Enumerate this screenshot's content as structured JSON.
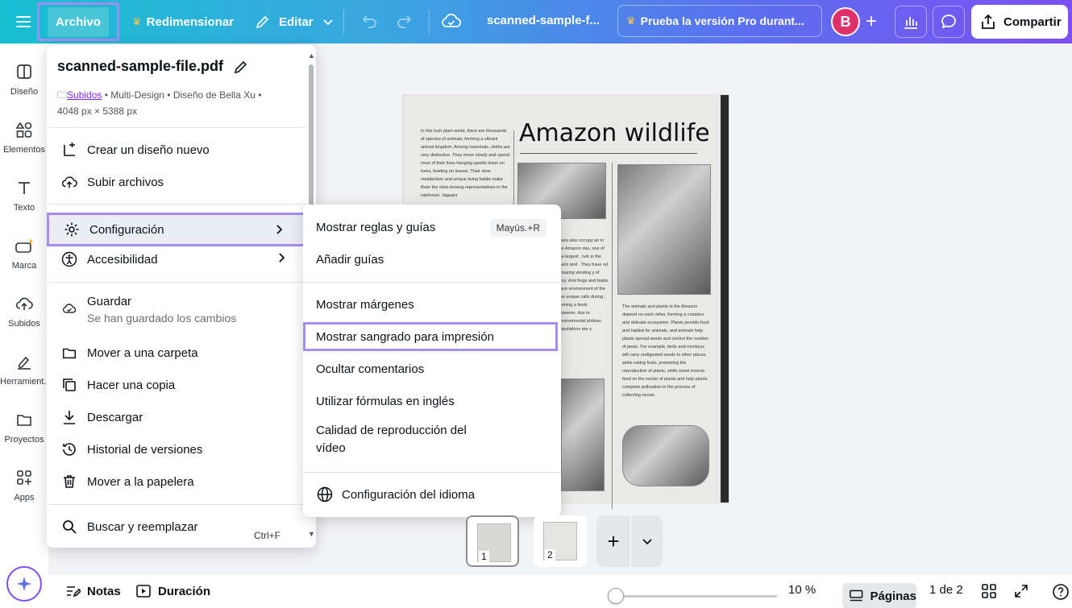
{
  "topbar": {
    "archivo": "Archivo",
    "resize": "Redimensionar",
    "edit": "Editar",
    "doc_name": "scanned-sample-f...",
    "pro_trial": "Prueba la versión Pro durant...",
    "avatar_initial": "B",
    "share": "Compartir"
  },
  "sidebar": {
    "items": [
      {
        "label": "Diseño"
      },
      {
        "label": "Elementos"
      },
      {
        "label": "Texto"
      },
      {
        "label": "Marca"
      },
      {
        "label": "Subidos"
      },
      {
        "label": "Herramient..."
      },
      {
        "label": "Proyectos"
      },
      {
        "label": "Apps"
      }
    ]
  },
  "file_menu": {
    "file_name": "scanned-sample-file.pdf",
    "meta_link": "Subidos",
    "meta_rest": " • Multi-Design • Diseño de Bella Xu •",
    "meta_size": "4048 px × 5388 px",
    "items": {
      "new_design": "Crear un diseño nuevo",
      "upload": "Subir archivos",
      "settings": "Configuración",
      "accessibility": "Accesibilidad",
      "save": "Guardar",
      "save_status": "Se han guardado los cambios",
      "move_folder": "Mover a una carpeta",
      "copy": "Hacer una copia",
      "download": "Descargar",
      "history": "Historial de versiones",
      "trash": "Mover a la papelera",
      "find_replace": "Buscar y reemplazar",
      "find_shortcut": "Ctrl+F"
    }
  },
  "settings_menu": {
    "rulers": "Mostrar reglas y guías",
    "rulers_shortcut": "Mayús.+R",
    "add_guides": "Añadir guías",
    "margins": "Mostrar márgenes",
    "bleed": "Mostrar sangrado para impresión",
    "hide_comments": "Ocultar comentarios",
    "english_formulas": "Utilizar fórmulas en inglés",
    "video_quality_1": "Calidad de reproducción del",
    "video_quality_2": "vídeo",
    "language": "Configuración del idioma"
  },
  "document": {
    "title": "Amazon wildlife",
    "col1": "In this lush plant world, there are thousands of species of animals, forming a vibrant animal kingdom. Among mammals, sloths are very distinctive. They move slowly and spend most of their lives hanging upside down on trees, feeding on leaves. Their slow metabolism and unique living habits make them the slow-moving representatives in the rainforest. Jaguars",
    "col2": "bians also occupy an in the Amazon das, one of the largest , lurk in the rivers and . They have nd amazing winding y of prey. And frogs and toads have environment of the ake unique calls during , forming a lively . However, due to environmental phibian populations are s.",
    "col3": "The animals and plants in the Amazon depend on each other, forming a complex and delicate ecosystem. Plants provide food and habitat for animals, and animals help plants spread seeds and control the number of pests. For example, birds and monkeys will carry undigested seeds to other places while eating fruits, promoting the reproduction of plants, while some insects feed on the nectar of plants and help plants complete pollination in the process of collecting nectar."
  },
  "pages": {
    "thumb1": "1",
    "thumb2": "2"
  },
  "bottombar": {
    "notes": "Notas",
    "duration": "Duración",
    "zoom": "10 %",
    "zoom_fraction": 0.0,
    "pages": "Páginas",
    "page_count": "1 de 2"
  }
}
